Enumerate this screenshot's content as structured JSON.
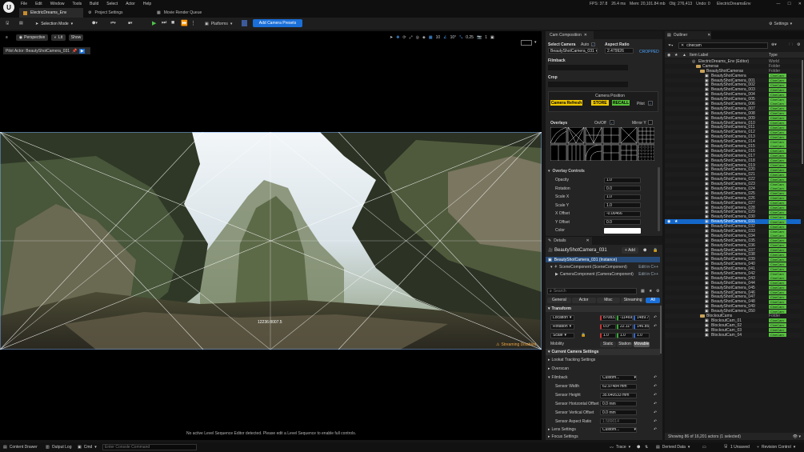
{
  "menu": {
    "items": [
      "File",
      "Edit",
      "Window",
      "Tools",
      "Build",
      "Select",
      "Actor",
      "Help"
    ],
    "stats": [
      "FPS: 37.8",
      "26.4 ms",
      "Mem: 20,101.84 mb",
      "Obj: 276,413",
      "Undo: 0"
    ],
    "project_name": "ElectricDreamsEnv"
  },
  "tabs": [
    "ElectricDreams_Env",
    "Project Settings",
    "Movie Render Queue"
  ],
  "toolbar": {
    "mode": "Selection Mode",
    "platforms": "Platforms",
    "add_presets": "Add Camera Presets",
    "settings": "Settings"
  },
  "viewport": {
    "perspective": "Perspective",
    "lit": "Lit",
    "show": "Show",
    "pilot": "Pilot Actor: BeautyShotCamera_031",
    "snap_values": [
      "10",
      "10°",
      "0.25",
      "1"
    ],
    "resolution": "12236:8007.5",
    "streaming": "Streaming Disabled",
    "footer_msg": "No active Level Sequence Editor detected. Please edit a Level Sequence to enable full controls."
  },
  "cam_comp": {
    "tab": "Cam Composition",
    "select_camera": "Select Camera",
    "auto": "Auto",
    "camera_value": "BeautyShotCamera_031",
    "aspect_ratio": "Aspect Ratio",
    "aspect_value": "2.479926",
    "cropped": "CROPPED",
    "filmback": "Filmback",
    "crop": "Crop",
    "camera_position": "Camera Position",
    "camera_refresh": "Camera Refresh",
    "store": "STORE",
    "recall": "RECALL",
    "pilot": "Pilot",
    "overlays": "Overlays",
    "onoff": "On/Off",
    "mirror": "Mirror Y",
    "overlay_controls": "Overlay Controls",
    "controls": [
      {
        "label": "Opacity",
        "value": "1.0"
      },
      {
        "label": "Rotation",
        "value": "0.0"
      },
      {
        "label": "Scale X",
        "value": "1.0"
      },
      {
        "label": "Scale Y",
        "value": "1.0"
      },
      {
        "label": "X Offset",
        "value": "-0.00466"
      },
      {
        "label": "Y Offset",
        "value": "0.0"
      },
      {
        "label": "Color",
        "value": ""
      }
    ]
  },
  "details": {
    "tab": "Details",
    "actor": "BeautyShotCamera_031",
    "add": "+ Add",
    "instance": "BeautyShotCamera_031 (Instance)",
    "components": [
      {
        "label": "SceneComponent (SceneComponent)",
        "edit": "Edit in C++"
      },
      {
        "label": "CameraComponent (CameraComponent)",
        "edit": "Edit in C++"
      }
    ],
    "search_placeholder": "Search",
    "filters": [
      "General",
      "Actor",
      "Misc",
      "Streaming",
      "All"
    ],
    "transform": "Transform",
    "location": "Location",
    "loc_vals": [
      "87083.1",
      "-11469",
      "1489.7"
    ],
    "rotation": "Rotation",
    "rot_vals": [
      "0.0°",
      "22.11°",
      "146.85°"
    ],
    "scale": "Scale",
    "scale_vals": [
      "1.0",
      "1.0",
      "1.0"
    ],
    "mobility": "Mobility",
    "mob_opts": [
      "Static",
      "Station",
      "Movable"
    ],
    "current_camera": "Current Camera Settings",
    "lookat": "Lookat Tracking Settings",
    "overscan": "Overscan",
    "filmback": "Filmback",
    "filmback_val": "Custom...",
    "sensor": [
      {
        "label": "Sensor Width",
        "value": "62.97484 mm"
      },
      {
        "label": "Sensor Height",
        "value": "35.640533 mm"
      },
      {
        "label": "Sensor Horizontal Offset",
        "value": "0.0 mm"
      },
      {
        "label": "Sensor Vertical Offset",
        "value": "0.0 mm"
      },
      {
        "label": "Sensor Aspect Ratio",
        "value": "1.589014"
      }
    ],
    "lens": "Lens Settings",
    "lens_val": "Custom...",
    "focus": "Focus Settings"
  },
  "outliner": {
    "tab": "Outliner",
    "search": "cinecam",
    "col_label": "Item Label",
    "col_type": "Type",
    "tree": [
      {
        "label": "ElectricDreams_Env (Editor)",
        "type": "World",
        "depth": 0
      },
      {
        "label": "Cameras",
        "type": "Folder",
        "depth": 1
      },
      {
        "label": "BeautyShotCameras",
        "type": "Folder",
        "depth": 2
      }
    ],
    "cameras": [
      "BeautyShotCamera",
      "BeautyShotCamera_001",
      "BeautyShotCamera_002",
      "BeautyShotCamera_003",
      "BeautyShotCamera_004",
      "BeautyShotCamera_005",
      "BeautyShotCamera_006",
      "BeautyShotCamera_007",
      "BeautyShotCamera_008",
      "BeautyShotCamera_009",
      "BeautyShotCamera_010",
      "BeautyShotCamera_011",
      "BeautyShotCamera_012",
      "BeautyShotCamera_013",
      "BeautyShotCamera_014",
      "BeautyShotCamera_015",
      "BeautyShotCamera_016",
      "BeautyShotCamera_017",
      "BeautyShotCamera_018",
      "BeautyShotCamera_019",
      "BeautyShotCamera_020",
      "BeautyShotCamera_021",
      "BeautyShotCamera_022",
      "BeautyShotCamera_023",
      "BeautyShotCamera_024",
      "BeautyShotCamera_025",
      "BeautyShotCamera_026",
      "BeautyShotCamera_027",
      "BeautyShotCamera_028",
      "BeautyShotCamera_029",
      "BeautyShotCamera_030",
      "BeautyShotCamera_031",
      "BeautyShotCamera_032",
      "BeautyShotCamera_033",
      "BeautyShotCamera_034",
      "BeautyShotCamera_035",
      "BeautyShotCamera_036",
      "BeautyShotCamera_037",
      "BeautyShotCamera_038",
      "BeautyShotCamera_039",
      "BeautyShotCamera_040",
      "BeautyShotCamera_041",
      "BeautyShotCamera_042",
      "BeautyShotCamera_043",
      "BeautyShotCamera_044",
      "BeautyShotCamera_045",
      "BeautyShotCamera_046",
      "BeautyShotCamera_047",
      "BeautyShotCamera_048",
      "BeautyShotCamera_049",
      "BeautyShotCamera_050"
    ],
    "selected": "BeautyShotCamera_031",
    "cam_type": "CineCam",
    "blockout_folder": "BlockoutCams",
    "blockout": [
      "BlockoutCam_01",
      "BlockoutCam_02",
      "BlockoutCam_03",
      "BlockoutCam_04"
    ],
    "footer": "Showing 86 of 16,201 actors (1 selected)"
  },
  "statusbar": {
    "content_drawer": "Content Drawer",
    "output_log": "Output Log",
    "cmd": "Cmd",
    "cmd_placeholder": "Enter Console Command",
    "trace": "Trace",
    "derived": "Derived Data",
    "unsaved": "1 Unsaved",
    "revision": "Revision Control"
  },
  "colors": {
    "accent": "#0070e0",
    "yellow": "#f0c800",
    "green": "#57c23a",
    "bg": "#151515",
    "panel": "#242424"
  }
}
